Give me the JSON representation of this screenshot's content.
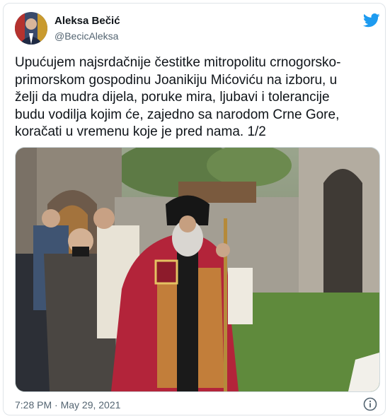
{
  "author": {
    "name": "Aleksa Bečić",
    "handle": "@BecicAleksa"
  },
  "icons": {
    "brand": "twitter-bird-icon",
    "info": "info-icon"
  },
  "colors": {
    "brand": "#1d9bf0",
    "text": "#0f1419",
    "secondary": "#536471"
  },
  "tweet": {
    "text": "Upućujem najsrdačnije čestitke mitropolitu crnogorsko-\nprimorskom gospodinu Joanikiju Mićoviću na izboru, u\nželji da mudra dijela, poruke mira, ljubavi i tolerancije\nbudu vodilja kojim će, zajedno sa narodom Crne Gore,\nkoračati u vremenu koje je pred nama. 1/2",
    "timestamp": "7:28 PM · May 29, 2021"
  }
}
